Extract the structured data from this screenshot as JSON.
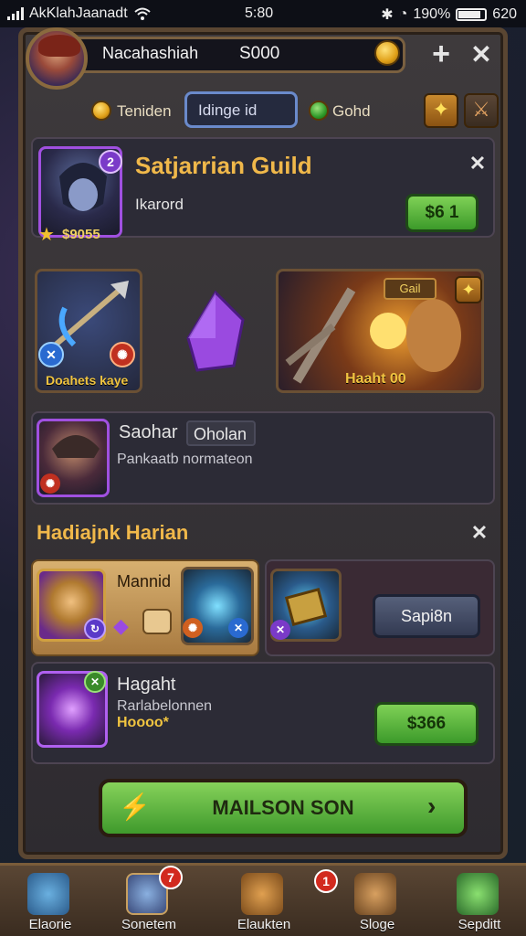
{
  "status": {
    "carrier": "AkKlahJaanadt",
    "time": "5:80",
    "battery": "190%",
    "right_text": "620"
  },
  "header": {
    "player_name": "Nacahashiah",
    "gold": "S000"
  },
  "tabs": {
    "tab1": "Teniden",
    "search_value": "Idinge id",
    "tab3": "Gohd"
  },
  "guild": {
    "title": "Satjarrian Guild",
    "subtitle": "Ikarord",
    "price_label": "$6 1",
    "portrait_value": "$9055"
  },
  "items": {
    "left_caption": "Doahets kaye",
    "right_badge": "Gail",
    "right_caption": "Haaht 00"
  },
  "member": {
    "name": "Saohar",
    "tag": "Oholan",
    "description": "Pankaatb normateon"
  },
  "section": {
    "title": "Hadiajnk Harian"
  },
  "offer1": {
    "name": "Mannid",
    "button": "Sapi8n"
  },
  "offer2": {
    "name": "Hagaht",
    "desc": "Rarlabelonnen",
    "amount": "Hoooo*",
    "price": "$366"
  },
  "main_button": "MAILSON SON",
  "nav": {
    "items": [
      {
        "label": "Elaorie"
      },
      {
        "label": "Sonetem",
        "badge": "7"
      },
      {
        "label": "Elaukten",
        "badge": "1"
      },
      {
        "label": "Sloge"
      },
      {
        "label": "Sepditt"
      }
    ]
  },
  "colors": {
    "accent_gold": "#f0b84a",
    "green_button": "#5cb23e",
    "frame_brown": "#5a4632"
  }
}
